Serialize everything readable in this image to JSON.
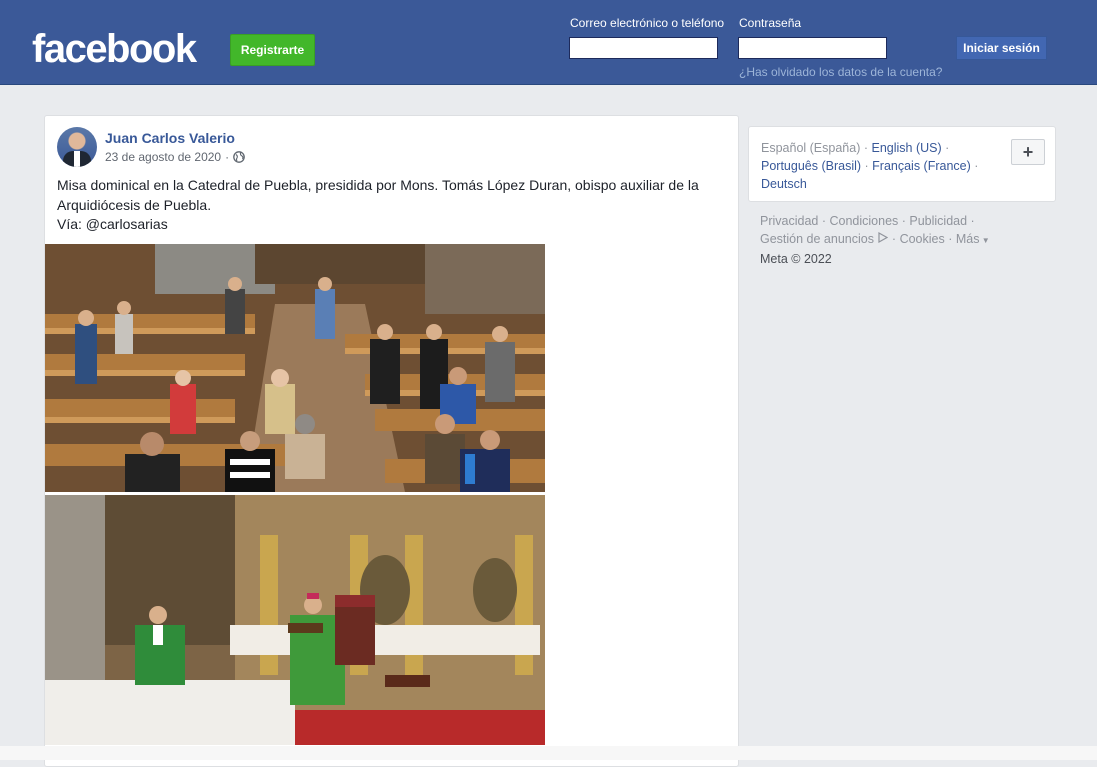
{
  "header": {
    "logo": "facebook",
    "signup_label": "Registrarte",
    "email_label": "Correo electrónico o teléfono",
    "password_label": "Contraseña",
    "email_value": "",
    "password_value": "",
    "login_label": "Iniciar sesión",
    "forgot_label": "¿Has olvidado los datos de la cuenta?"
  },
  "post": {
    "author": "Juan Carlos Valerio",
    "date": "23 de agosto de 2020",
    "date_separator": "·",
    "privacy_icon": "globe-icon",
    "text_line1": "Misa dominical en la Catedral de Puebla, presidida por Mons. Tomás López Duran, obispo auxiliar de la Arquidiócesis de Puebla.",
    "text_line2": "Vía: @carlosarias"
  },
  "sidebar": {
    "languages": [
      {
        "label": "Español (España)",
        "current": true
      },
      {
        "label": "English (US)",
        "current": false
      },
      {
        "label": "Português (Brasil)",
        "current": false
      },
      {
        "label": "Français (France)",
        "current": false
      },
      {
        "label": "Deutsch",
        "current": false
      }
    ],
    "more_languages_label": "+",
    "footer": {
      "privacy": "Privacidad",
      "terms": "Condiciones",
      "advertising": "Publicidad",
      "ad_choices": "Gestión de anuncios",
      "cookies": "Cookies",
      "more": "Más",
      "copyright": "Meta © 2022"
    }
  },
  "colors": {
    "brand_blue": "#3b5998",
    "signup_green": "#42b72a",
    "link_blue": "#385898",
    "page_bg": "#e9ebee"
  }
}
